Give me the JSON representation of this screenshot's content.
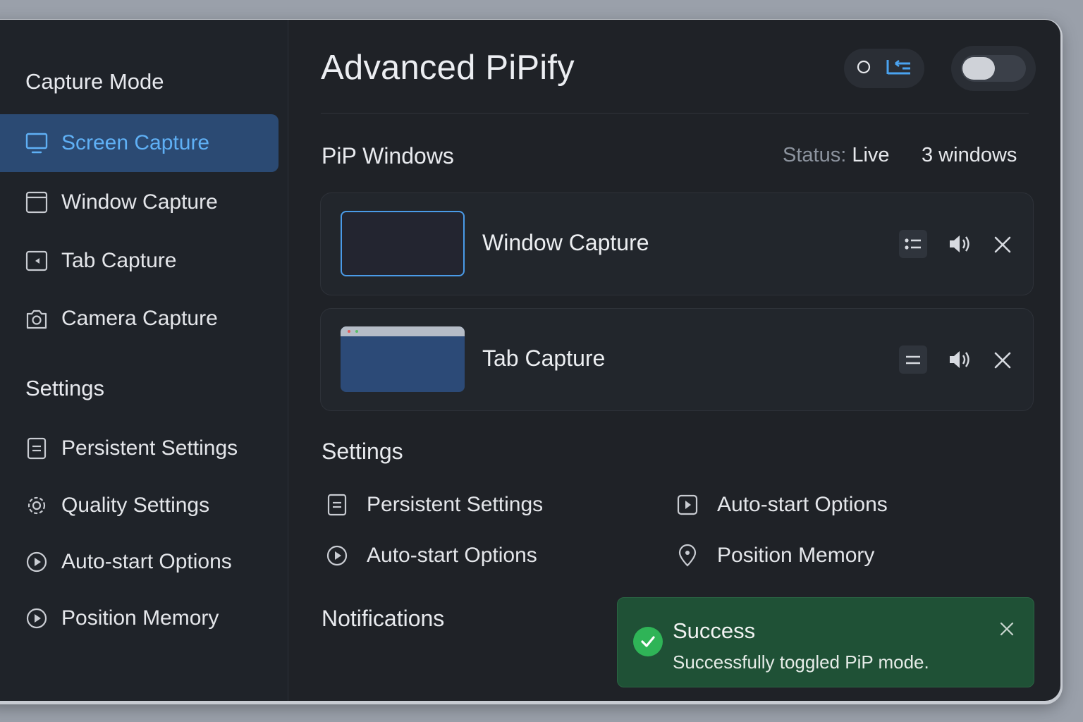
{
  "app": {
    "title": "Advanced PiPify"
  },
  "sidebar": {
    "capture_heading": "Capture Mode",
    "capture_items": [
      {
        "label": "Screen Capture",
        "icon": "monitor-icon",
        "active": true
      },
      {
        "label": "Window Capture",
        "icon": "window-icon"
      },
      {
        "label": "Tab Capture",
        "icon": "tab-icon"
      },
      {
        "label": "Camera Capture",
        "icon": "camera-icon"
      }
    ],
    "settings_heading": "Settings",
    "settings_items": [
      {
        "label": "Persistent Settings",
        "icon": "document-icon"
      },
      {
        "label": "Quality Settings",
        "icon": "gear-icon"
      },
      {
        "label": "Auto-start Options",
        "icon": "play-circle-icon"
      },
      {
        "label": "Position Memory",
        "icon": "play-circle-icon"
      }
    ]
  },
  "header": {
    "toggle_on": false
  },
  "pip": {
    "heading": "PiP Windows",
    "status_label": "Status:",
    "status_value": "Live",
    "count": "3 windows",
    "windows": [
      {
        "title": "Window Capture",
        "icon": "list-icon"
      },
      {
        "title": "Tab Capture",
        "icon": "equals-icon"
      }
    ]
  },
  "settings": {
    "heading": "Settings",
    "items": [
      {
        "label": "Persistent Settings",
        "icon": "document-icon"
      },
      {
        "label": "Auto-start Options",
        "icon": "play-square-icon"
      },
      {
        "label": "Auto-start Options",
        "icon": "play-circle-icon"
      },
      {
        "label": "Position Memory",
        "icon": "location-pin-icon"
      }
    ]
  },
  "notifications": {
    "heading": "Notifications",
    "toast": {
      "title": "Success",
      "message": "Successfully toggled PiP mode."
    }
  },
  "colors": {
    "accent": "#5fb0f5",
    "success": "#1f5136",
    "background": "#1f2227"
  }
}
